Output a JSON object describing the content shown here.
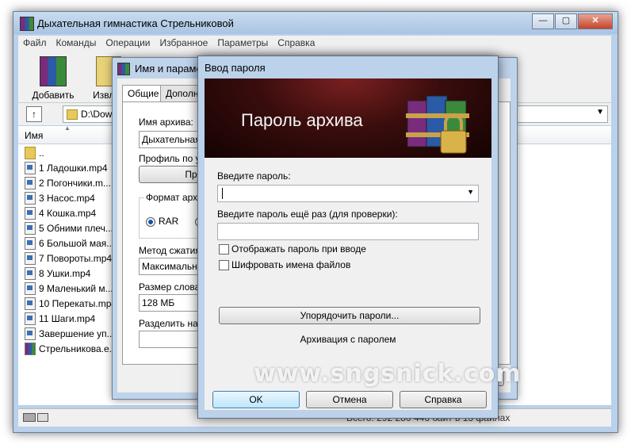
{
  "main": {
    "title": "Дыхательная гимнастика Стрельниковой",
    "window_buttons": [
      "—",
      "▢",
      "✕"
    ],
    "menu": [
      "Файл",
      "Команды",
      "Операции",
      "Избранное",
      "Параметры",
      "Справка"
    ],
    "toolbar": {
      "add": "Добавить",
      "extract": "Извлеч"
    },
    "path": "D:\\Dow",
    "column_name": "Имя",
    "files": [
      "..",
      "1 Ладошки.mp4",
      "2 Погончики.m...",
      "3 Насос.mp4",
      "4 Кошка.mp4",
      "5 Обними плеч...",
      "6 Большой мая...",
      "7 Повороты.mp4",
      "8 Ушки.mp4",
      "9 Маленький м...",
      "10 Перекаты.mp4",
      "11 Шаги.mp4",
      "Завершение уп...",
      "Стрельникова.е..."
    ],
    "status": "Всего: 292 280 446 байт в 13 файлах"
  },
  "archive_dialog": {
    "title": "Имя и параметр",
    "tabs": [
      "Общие",
      "Дополн"
    ],
    "name_label": "Имя архива:",
    "name_value": "Дыхательная",
    "profile_label": "Профиль по умо",
    "profile_button": "Пр",
    "format_label": "Формат архив",
    "format_rar": "RAR",
    "method_label": "Метод сжатия:",
    "method_value": "Максимальный",
    "dict_label": "Размер словаря",
    "dict_value": "128 МБ",
    "split_label": "Разделить на т"
  },
  "password_dialog": {
    "title": "Ввод пароля",
    "banner": "Пароль архива",
    "enter_label": "Введите пароль:",
    "reenter_label": "Введите пароль ещё раз (для проверки):",
    "show_password": "Отображать пароль при вводе",
    "encrypt_names": "Шифровать имена файлов",
    "organize_button": "Упорядочить пароли...",
    "caption": "Архивация с паролем",
    "ok": "OK",
    "cancel": "Отмена",
    "help": "Справка"
  },
  "watermark": "www.sngsnick.com"
}
